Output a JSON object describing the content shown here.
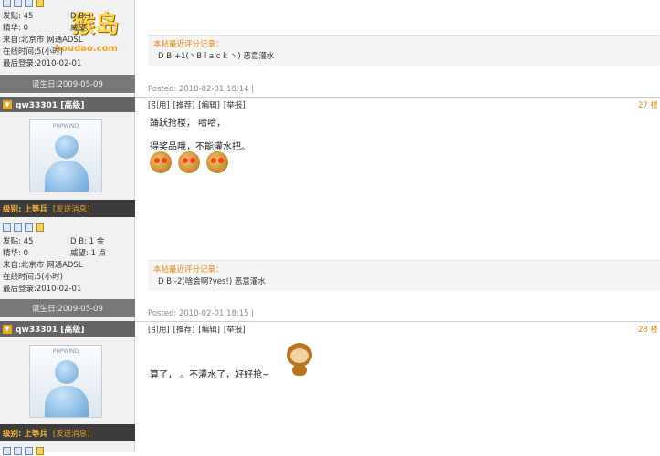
{
  "logo": {
    "text": "猴岛",
    "url": "houdao.com"
  },
  "profiles": [
    {
      "stats": [
        [
          "发贴: 45",
          "D B:+"
        ],
        [
          "精华: 0",
          "威望:"
        ],
        [
          "来自:北京市 网通ADSL",
          ""
        ],
        [
          "在线时间:5(小时)",
          ""
        ],
        [
          "最后登录:2010-02-01",
          ""
        ]
      ],
      "birthday": "诞生日:2009-05-09"
    },
    {
      "username": "qw33301 [高级]",
      "avatar_tag": "PHPWIND",
      "level": "级别: 上等兵",
      "send_msg": "[发送消息]",
      "stats": [
        [
          "发贴: 45",
          "D B: 1 金"
        ],
        [
          "精华: 0",
          "威望: 1 点"
        ],
        [
          "来自:北京市 网通ADSL",
          ""
        ],
        [
          "在线时间:5(小时)",
          ""
        ],
        [
          "最后登录:2010-02-01",
          ""
        ]
      ],
      "birthday": "诞生日:2009-05-09"
    },
    {
      "username": "qw33301 [高级]",
      "avatar_tag": "PHPWIND",
      "level": "级别: 上等兵",
      "send_msg": "[发送消息]"
    }
  ],
  "posts": [
    {
      "rate_title": "本帖最近评分记录：",
      "rate_body": "D B:+1(丶B l a c k 丶) 恶意灌水",
      "posted": "Posted: 2010-02-01 18:14 |"
    },
    {
      "actions": [
        "[引用]",
        "[推荐]",
        "[编辑]",
        "[举报]"
      ],
      "floor": "27 楼",
      "lines": [
        "踊跃抢楼，  哈哈，",
        "得奖品哦，不能灌水把。"
      ],
      "rate_title": "本帖最近评分记录：",
      "rate_body": "D B:-2(啥会啊?yes!) 恶意灌水",
      "posted": "Posted: 2010-02-01 18:15 |"
    },
    {
      "actions": [
        "[引用]",
        "[推荐]",
        "[编辑]",
        "[举报]"
      ],
      "floor": "28 楼",
      "lines": [
        "算了， 。不灌水了，好好抢~"
      ]
    }
  ]
}
